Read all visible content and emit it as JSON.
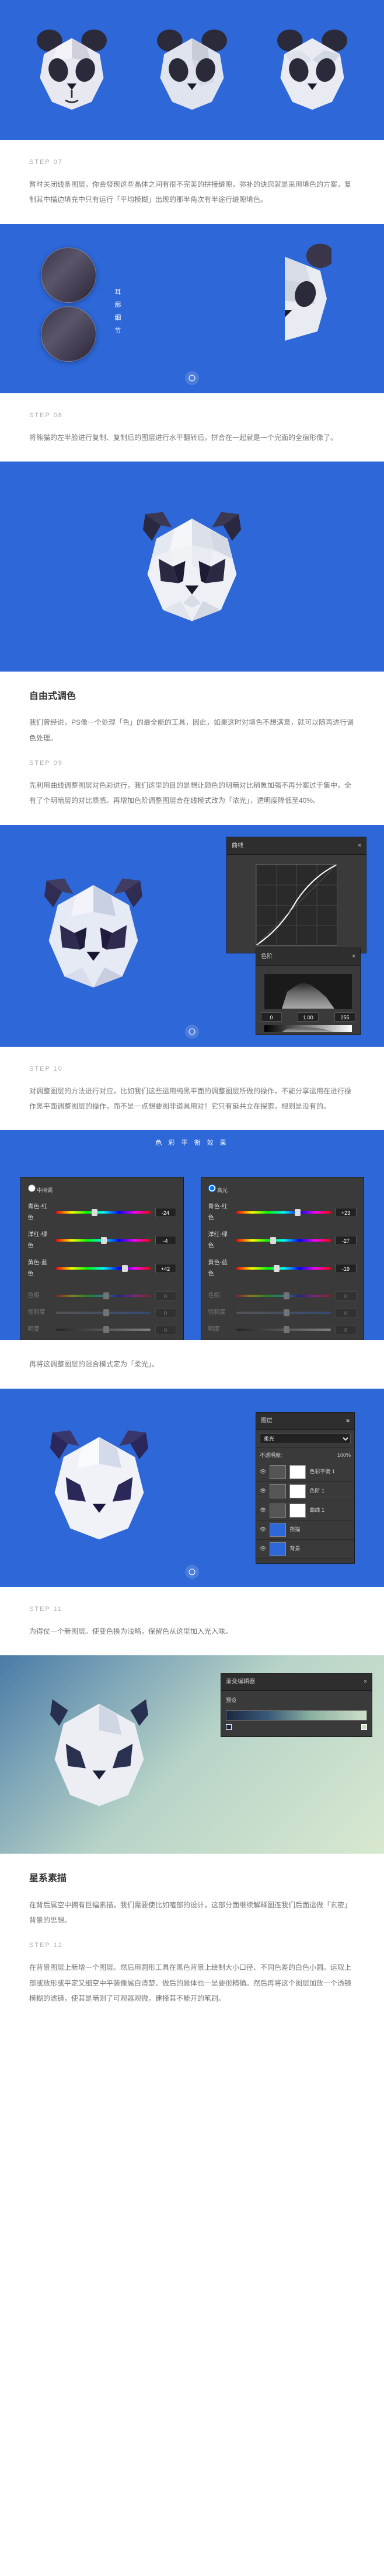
{
  "step07": {
    "label": "STEP 07",
    "body": "暂时关闭线条图层，你会發现这些晶体之间有很不完美的拼接缝隙，弥补的诀窍就是采用填色的方案，复制其中描边填充中只有运行「平均模糊」出现的那半角次有半途行缝隙填色。"
  },
  "step08": {
    "label": "STEP 08",
    "detail_label": "耳 廓 细 节",
    "body": "将熊猫的左半脸进行复制、复制后的图层进行水平翻转后，拼合在一起就是一个完面的全宿形像了。"
  },
  "step09": {
    "title": "自由式调色",
    "body1": "我们曾经说，PS像一个处理「色」的最全能的工具，因此，如果这时对填色不想满意，就可以随再进行调色处理。",
    "label": "STEP 09",
    "body2": "先利用曲线调整图层对色彩进行，我们这里的目的是想让颜色的明暗对比稍象加强不再分案过于集中，全有了个明暗层的对比质感。再增加色阶调整图层合在线模式改为「浓光」，透明度降低至40%。"
  },
  "step10": {
    "label": "STEP 10",
    "body": "对调整图层的方法进行对应，比如我们这些运用纯黑平面的调整图层所做的操作，不能分享运用在进行操作黑平面调整图层的操作，而不是一点想要图非道具用对！它只有延共立在探索，规则是没有的。",
    "caption": "色 彩 平 衡 效 果",
    "body2": "再将这调整图层的混合模式定为「柔光」。",
    "panel_left": {
      "opts": [
        "中间调"
      ],
      "cyan_red": "青色-红色",
      "magenta_green": "洋红-绿色",
      "yellow_blue": "黄色-蓝色",
      "v1": "-24",
      "v2": "-4",
      "v3": "+42"
    },
    "panel_right": {
      "opts": [
        "高光"
      ],
      "v1": "+23",
      "v2": "-27",
      "v3": "-19"
    }
  },
  "step11": {
    "label": "STEP 11",
    "body": "为得仗一个新图层。使变色换为浅略，保留色从这里加入光入味。"
  },
  "section_stars": {
    "title": "星系素描",
    "body": "在背后属空中拥有巨幅素描，我们需要使比如喧部的设计，这部分面继续解释图连我们后面运做「玄密」背景的思想。",
    "label": "STEP 12",
    "body2": "在背景图层上新增一个图层。然后用圆形工具在黑色背景上绘制大小口径、不同色差的白色小圆。运取上部或放形或平定又细空中平装像属白清楚、做后的晨体也一是要很精确。然后再将这个图层加放一个透镜模糊的滤镜，使其是暗则了可观器观微，建择其不能开的笔刷。"
  },
  "ps_ui": {
    "curves_title": "曲线",
    "levels_title": "色阶",
    "blend_mode": "柔光",
    "opacity_label": "不透明度:",
    "opacity_val": "100%",
    "gradient_title": "渐变编辑器",
    "preset_label": "预设",
    "hue": "色相",
    "sat": "饱和度",
    "light": "明度"
  }
}
